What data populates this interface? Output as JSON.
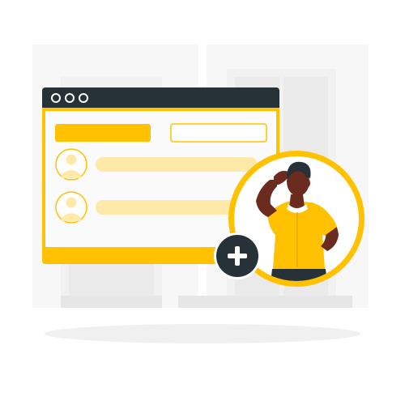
{
  "colors": {
    "accent": "#FFC100",
    "accent_light": "#FFE9A8",
    "dark": "#263238",
    "skin": "#6B2B1F",
    "background_furniture": "#F5F5F5",
    "floor_shadow": "#F0F0F0"
  },
  "window": {
    "controls": [
      "close-dot",
      "minimize-dot",
      "maximize-dot"
    ],
    "rows": [
      {
        "avatar": "user-icon"
      },
      {
        "avatar": "user-icon"
      }
    ]
  },
  "add_button": {
    "icon": "plus-icon"
  },
  "person": {
    "illustration": "person-with-yellow-shirt"
  }
}
